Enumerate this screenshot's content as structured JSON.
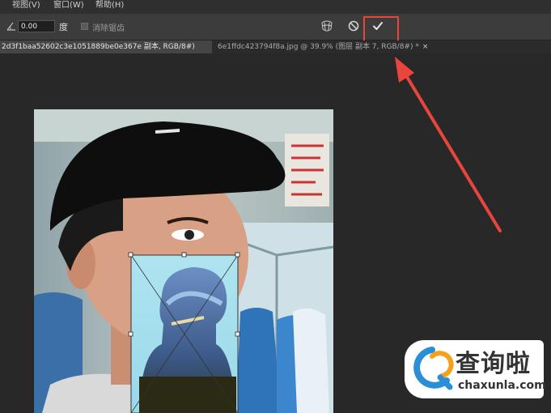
{
  "menu": {
    "items": [
      "视图(V)",
      "窗口(W)",
      "帮助(H)"
    ]
  },
  "options_bar": {
    "angle_value": "0.00",
    "angle_unit": "度",
    "antialias_label": "消除锯齿",
    "icons": [
      "angle-icon",
      "warp-icon",
      "cancel-icon",
      "commit-check-icon"
    ]
  },
  "tabs": [
    {
      "label": "2d3f1baa52602c3e1051889be0e367e 副本, RGB/8#)",
      "close": "×",
      "active": true
    },
    {
      "label": "6e1ffdc423794f8a.jpg @ 39.9% (图层   副本 7, RGB/8#) *",
      "close": "×",
      "active": false
    }
  ],
  "watermark": {
    "brand_cn": "查询啦",
    "url": "chaxunla.com"
  },
  "colors": {
    "highlight": "#e8453c",
    "arrow": "#e8453c",
    "toolbar": "#3c3c3c",
    "canvas": "#282828"
  }
}
